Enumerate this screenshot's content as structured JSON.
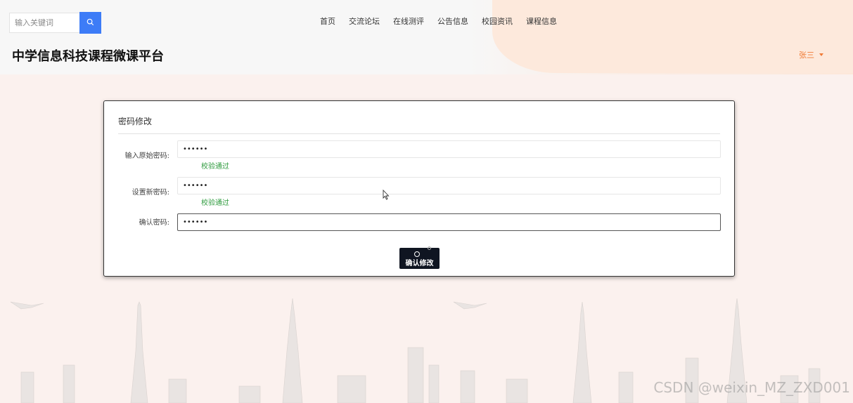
{
  "header": {
    "search": {
      "placeholder": "输入关键词",
      "icon": "search-icon"
    },
    "nav": [
      "首页",
      "交流论坛",
      "在线测评",
      "公告信息",
      "校园资讯",
      "课程信息"
    ],
    "site_title": "中学信息科技课程微课平台",
    "user": {
      "name": "张三",
      "icon": "caret-down-icon"
    }
  },
  "form": {
    "title": "密码修改",
    "fields": [
      {
        "label": "输入原始密码:",
        "value": "••••••",
        "validation": "校验通过"
      },
      {
        "label": "设置新密码:",
        "value": "••••••",
        "validation": "校验通过"
      },
      {
        "label": "确认密码:",
        "value": "••••••",
        "validation": ""
      }
    ],
    "submit_label": "确认修改"
  },
  "watermark": "CSDN @weixin_MZ_ZXD001",
  "colors": {
    "accent": "#3d7cf7",
    "user": "#f07a35",
    "valid": "#2e9b3e",
    "button": "#0f1521"
  }
}
